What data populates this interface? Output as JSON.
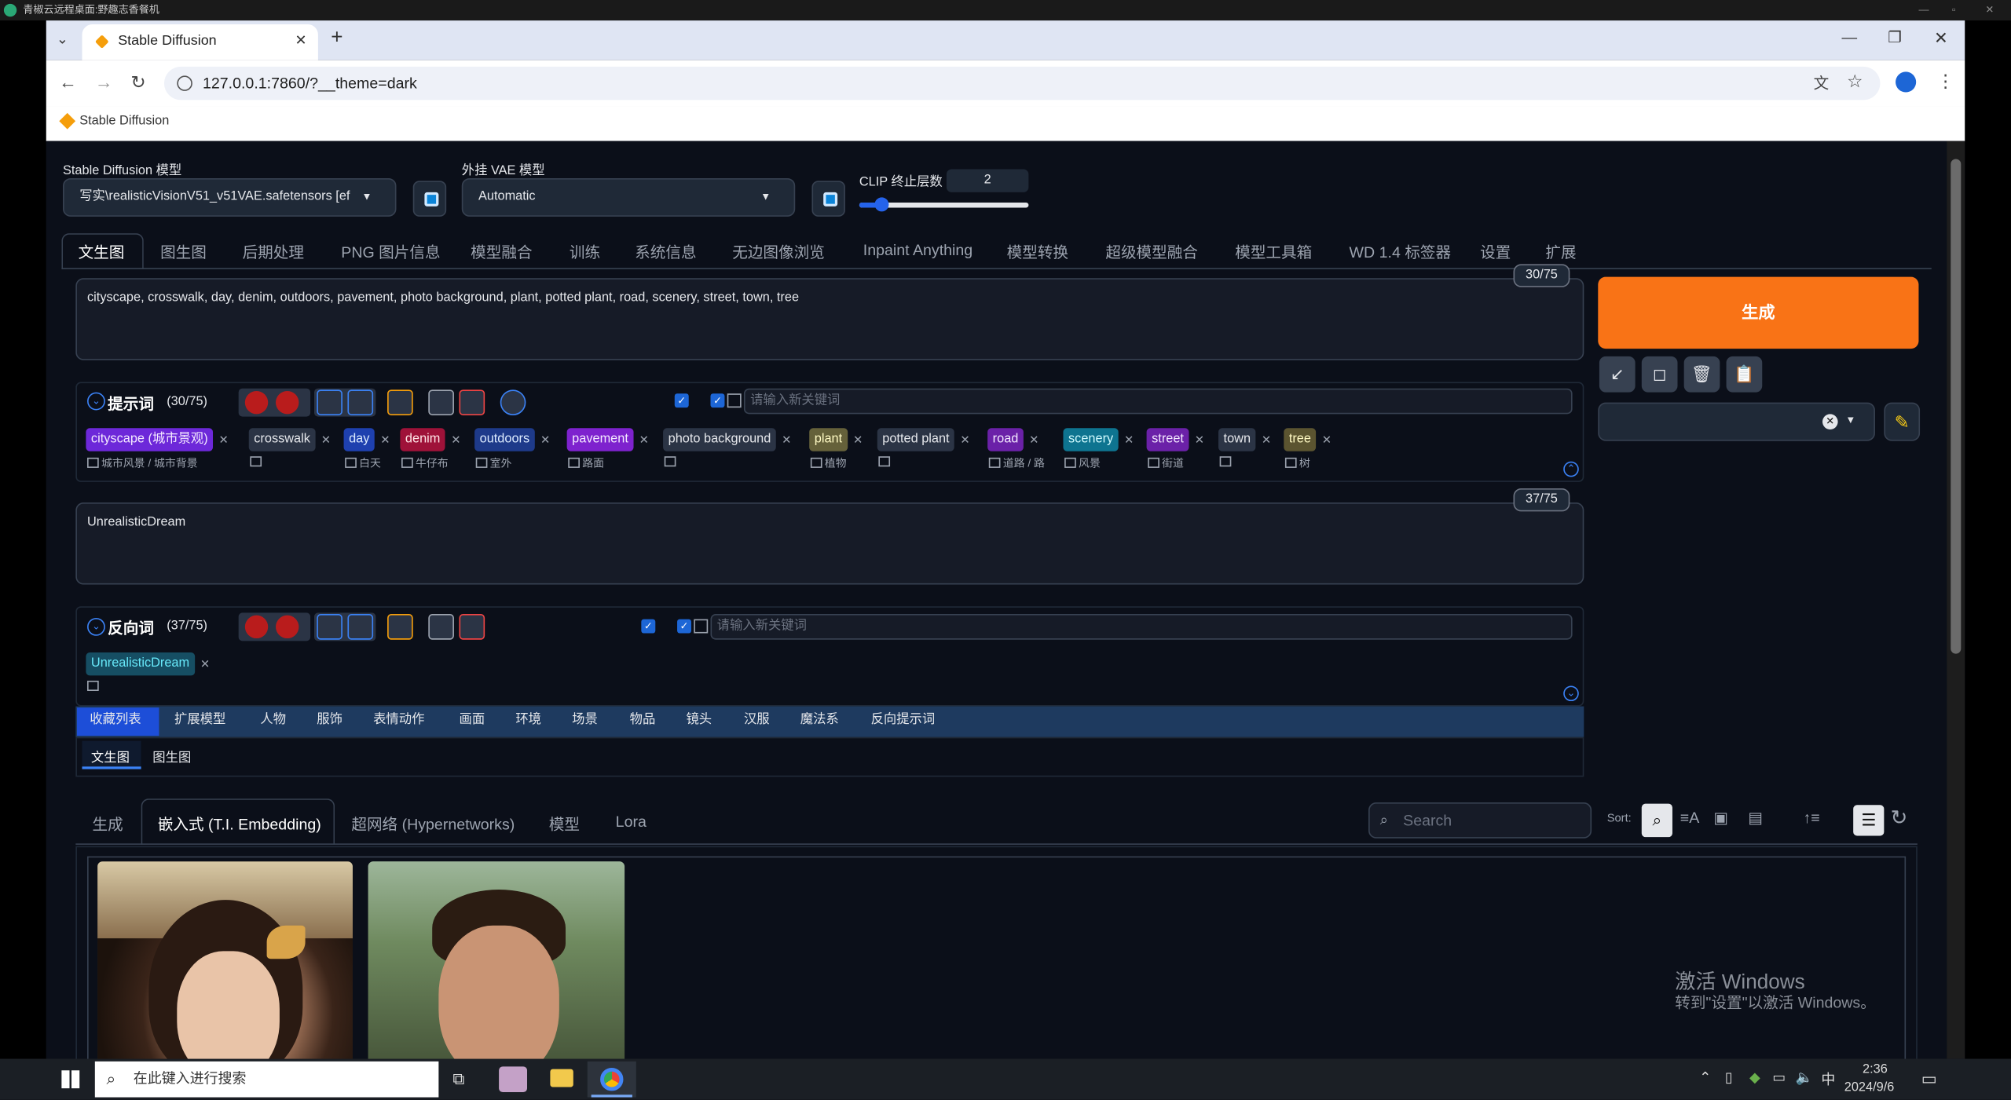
{
  "remote": {
    "title": "青椒云远程桌面:野趣志香餐机"
  },
  "browser": {
    "tab_title": "Stable Diffusion",
    "url": "127.0.0.1:7860/?__theme=dark",
    "bookmark": "Stable Diffusion"
  },
  "settings": {
    "sd_model_label": "Stable Diffusion 模型",
    "sd_model_value": "写实\\realisticVisionV51_v51VAE.safetensors [ef",
    "vae_label": "外挂 VAE 模型",
    "vae_value": "Automatic",
    "clip_label": "CLIP 终止层数",
    "clip_value": "2"
  },
  "tabs": [
    "文生图",
    "图生图",
    "后期处理",
    "PNG 图片信息",
    "模型融合",
    "训练",
    "系统信息",
    "无边图像浏览",
    "Inpaint Anything",
    "模型转换",
    "超级模型融合",
    "模型工具箱",
    "WD 1.4 标签器",
    "设置",
    "扩展"
  ],
  "prompt": {
    "text": "cityscape, crosswalk, day, denim, outdoors, pavement, photo background, plant, potted plant, road, scenery, street, town, tree",
    "counter": "30/75",
    "section_title": "提示词",
    "section_count": "(30/75)",
    "input_placeholder": "请输入新关键词",
    "tags": [
      {
        "text": "cityscape (城市景观)",
        "tr": "城市风景 / 城市背景",
        "bg": "#6d28d9",
        "fg": "#f3e8ff"
      },
      {
        "text": "crosswalk",
        "tr": "",
        "bg": "#2b3445",
        "fg": "#e5e7eb"
      },
      {
        "text": "day",
        "tr": "白天",
        "bg": "#1e40af",
        "fg": "#dbeafe"
      },
      {
        "text": "denim",
        "tr": "牛仔布",
        "bg": "#9f1239",
        "fg": "#ffe4e6"
      },
      {
        "text": "outdoors",
        "tr": "室外",
        "bg": "#1e3a8a",
        "fg": "#dbeafe"
      },
      {
        "text": "pavement",
        "tr": "路面",
        "bg": "#7e22ce",
        "fg": "#f3e8ff"
      },
      {
        "text": "photo background",
        "tr": "",
        "bg": "#2b3445",
        "fg": "#e5e7eb"
      },
      {
        "text": "plant",
        "tr": "植物",
        "bg": "#65613a",
        "fg": "#fef9c3"
      },
      {
        "text": "potted plant",
        "tr": "",
        "bg": "#2b3445",
        "fg": "#e5e7eb"
      },
      {
        "text": "road",
        "tr": "道路 / 路",
        "bg": "#6b21a8",
        "fg": "#f3e8ff"
      },
      {
        "text": "scenery",
        "tr": "风景",
        "bg": "#0e7490",
        "fg": "#cffafe"
      },
      {
        "text": "street",
        "tr": "街道",
        "bg": "#6b21a8",
        "fg": "#f3e8ff"
      },
      {
        "text": "town",
        "tr": "",
        "bg": "#2b3445",
        "fg": "#e5e7eb"
      },
      {
        "text": "tree",
        "tr": "树",
        "bg": "#5b5430",
        "fg": "#fef9c3"
      }
    ]
  },
  "negative": {
    "text": "UnrealisticDream",
    "counter": "37/75",
    "section_title": "反向词",
    "section_count": "(37/75)",
    "input_placeholder": "请输入新关键词",
    "tag": "UnrealisticDream"
  },
  "categories": [
    "收藏列表",
    "扩展模型",
    "人物",
    "服饰",
    "表情动作",
    "画面",
    "环境",
    "场景",
    "物品",
    "镜头",
    "汉服",
    "魔法系",
    "反向提示词"
  ],
  "subtabs": [
    "文生图",
    "图生图"
  ],
  "generate_label": "生成",
  "tools": [
    "↙",
    "◻",
    "🗑",
    "📋"
  ],
  "bottom_tabs": [
    "生成",
    "嵌入式 (T.I. Embedding)",
    "超网络 (Hypernetworks)",
    "模型",
    "Lora"
  ],
  "search_placeholder": "Search",
  "sort_label": "Sort:",
  "watermark": {
    "line1": "激活 Windows",
    "line2": "转到\"设置\"以激活 Windows。"
  },
  "taskbar": {
    "search": "在此键入进行搜索",
    "time": "2:36",
    "date": "2024/9/6",
    "ime": "中"
  },
  "colors": {
    "accent": "#f97316",
    "bg": "#0b0f19",
    "panel": "#161b27",
    "category_bar": "#1e3a5f",
    "active_category": "#1d4ed8"
  }
}
